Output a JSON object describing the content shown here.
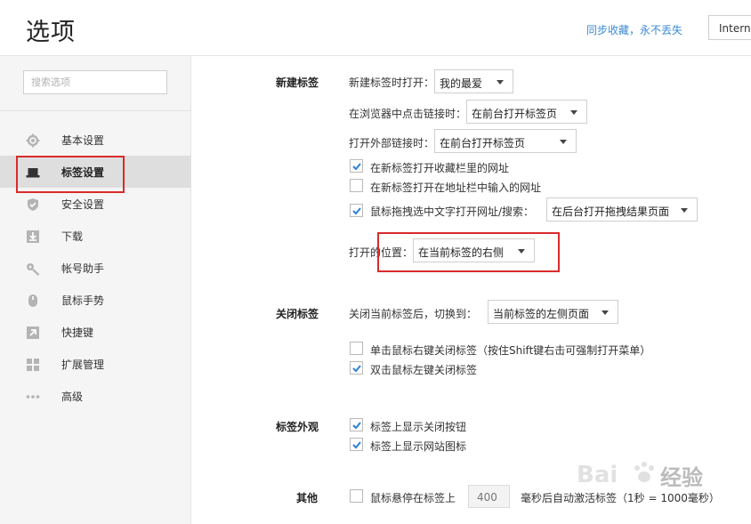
{
  "header": {
    "title": "选项",
    "sync_link": "同步收藏，永不丢失",
    "ie_label": "Interne"
  },
  "sidebar": {
    "search_placeholder": "搜索选项",
    "items": [
      {
        "label": "基本设置",
        "icon": "gear-icon"
      },
      {
        "label": "标签设置",
        "icon": "laptop-icon",
        "active": true
      },
      {
        "label": "安全设置",
        "icon": "shield-icon"
      },
      {
        "label": "下载",
        "icon": "download-icon"
      },
      {
        "label": "帐号助手",
        "icon": "key-icon"
      },
      {
        "label": "鼠标手势",
        "icon": "mouse-icon"
      },
      {
        "label": "快捷键",
        "icon": "shortcut-arrow-icon"
      },
      {
        "label": "扩展管理",
        "icon": "grid-icon"
      },
      {
        "label": "高级",
        "icon": "dots-icon"
      }
    ]
  },
  "new_tab": {
    "section_label": "新建标签",
    "open_new_label": "新建标签时打开：",
    "open_new_value": "我的最爱",
    "click_link_label": "在浏览器中点击链接时：",
    "click_link_value": "在前台打开标签页",
    "external_link_label": "打开外部链接时：",
    "external_link_value": "在前台打开标签页",
    "cb_favorites_label": "在新标签打开收藏栏里的网址",
    "cb_favorites_checked": true,
    "cb_addressbar_label": "在新标签打开在地址栏中输入的网址",
    "cb_addressbar_checked": false,
    "cb_drag_label": "鼠标拖拽选中文字打开网址/搜索：",
    "cb_drag_checked": true,
    "drag_value": "在后台打开拖拽结果页面",
    "position_label": "打开的位置：",
    "position_value": "在当前标签的右侧"
  },
  "close_tab": {
    "section_label": "关闭标签",
    "after_close_label": "关闭当前标签后，切换到：",
    "after_close_value": "当前标签的左侧页面",
    "cb_right_click_label": "单击鼠标右键关闭标签（按住Shift键右击可强制打开菜单）",
    "cb_right_click_checked": false,
    "cb_double_click_label": "双击鼠标左键关闭标签",
    "cb_double_click_checked": true
  },
  "tab_appearance": {
    "section_label": "标签外观",
    "cb_close_btn_label": "标签上显示关闭按钮",
    "cb_close_btn_checked": true,
    "cb_favicon_label": "标签上显示网站图标",
    "cb_favicon_checked": true
  },
  "other": {
    "section_label": "其他",
    "cb_hover_label": "鼠标悬停在标签上",
    "cb_hover_checked": false,
    "hover_ms_value": "400",
    "hover_suffix": "毫秒后自动激活标签（1秒 = 1000毫秒）"
  },
  "watermark": {
    "brand": "Bai",
    "brand_suffix": "经验"
  },
  "colors": {
    "accent": "#3a8ad6",
    "highlight": "#d92b2b",
    "check": "#2c7fd8"
  }
}
